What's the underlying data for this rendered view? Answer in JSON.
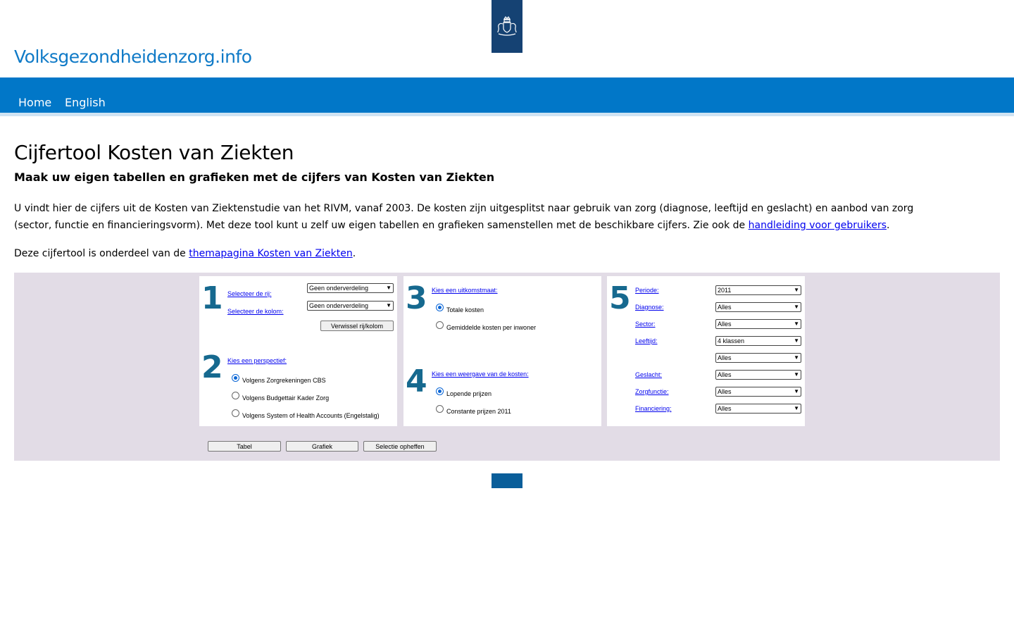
{
  "header": {
    "site_title": "Volksgezondheidenzorg.info",
    "logo_icon": "rijksoverheid-crest-icon",
    "brand_color": "#0177c8"
  },
  "nav": {
    "items": [
      {
        "label": "Home"
      },
      {
        "label": "English"
      }
    ]
  },
  "page": {
    "title": "Cijfertool Kosten van Ziekten",
    "subtitle": "Maak uw eigen tabellen en grafieken met de cijfers van Kosten van Ziekten",
    "intro_text": "U vindt hier de cijfers uit de Kosten van Ziektenstudie van het RIVM, vanaf 2003. De kosten zijn uitgesplitst naar gebruik van zorg (diagnose, leeftijd en geslacht) en aanbod van zorg (sector, functie en financieringsvorm). Met deze tool kunt u zelf uw eigen tabellen en grafieken samenstellen met de beschikbare cijfers. Zie ook de ",
    "intro_link": "handleiding voor gebruikers",
    "intro_end": ".",
    "intro2_text": "Deze cijfertool is onderdeel van de ",
    "intro2_link": "themapagina Kosten van Ziekten",
    "intro2_end": "."
  },
  "tool": {
    "panel1": {
      "step1": "1",
      "row_label": "Selecteer de rij:",
      "row_value": "Geen onderverdeling",
      "col_label": "Selecteer de kolom:",
      "col_value": "Geen onderverdeling",
      "swap_button": "Verwissel rij/kolom",
      "step2": "2",
      "perspective_label": "Kies een perspectief:",
      "perspectives": [
        {
          "label": "Volgens Zorgrekeningen CBS",
          "selected": true
        },
        {
          "label": "Volgens Budgettair Kader Zorg",
          "selected": false
        },
        {
          "label": "Volgens System of Health Accounts (Engelstalig)",
          "selected": false
        }
      ]
    },
    "panel2": {
      "step3": "3",
      "measure_label": "Kies een uitkomstmaat:",
      "measures": [
        {
          "label": "Totale kosten",
          "selected": true
        },
        {
          "label": "Gemiddelde kosten per inwoner",
          "selected": false
        }
      ],
      "step4": "4",
      "display_label": "Kies een weergave van de kosten:",
      "displays": [
        {
          "label": "Lopende prijzen",
          "selected": true
        },
        {
          "label": "Constante prijzen 2011",
          "selected": false
        }
      ]
    },
    "panel3": {
      "step5": "5",
      "filters": [
        {
          "label": "Periode:",
          "value": "2011"
        },
        {
          "label": "Diagnose:",
          "value": "Alles"
        },
        {
          "label": "Sector:",
          "value": "Alles"
        },
        {
          "label": "Leeftijd:",
          "value": "4 klassen"
        },
        {
          "label": "",
          "value": "Alles"
        },
        {
          "label": "Geslacht:",
          "value": "Alles"
        },
        {
          "label": "Zorgfunctie:",
          "value": "Alles"
        },
        {
          "label": "Financiering:",
          "value": "Alles"
        }
      ]
    },
    "buttons": {
      "table": "Tabel",
      "chart": "Grafiek",
      "reset": "Selectie opheffen"
    }
  }
}
